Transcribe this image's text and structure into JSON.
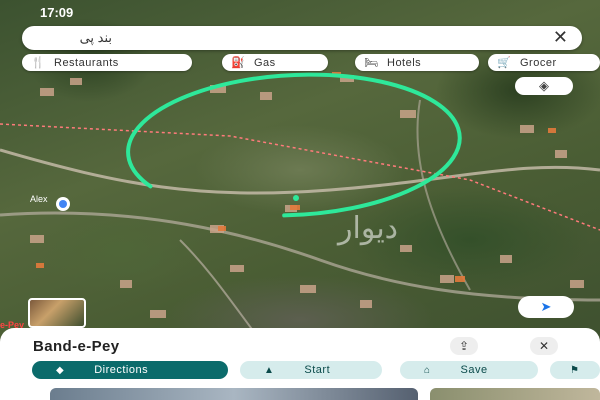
{
  "status_bar": {
    "time": "17:09"
  },
  "search": {
    "query": "بند پی",
    "clear_icon": "close-icon"
  },
  "chips": [
    {
      "label": "Restaurants",
      "icon": "restaurant-icon"
    },
    {
      "label": "Gas",
      "icon": "gas-station-icon"
    },
    {
      "label": "Hotels",
      "icon": "hotel-icon"
    },
    {
      "label": "Grocer",
      "icon": "cart-icon"
    }
  ],
  "map": {
    "layers_icon": "layers-icon",
    "location_label": "Alex",
    "thumbnail_caption": "e-Pey",
    "watermark": "دیوار",
    "locate_icon": "navigation-arrow-icon",
    "colors": {
      "circle": "#2ee89a",
      "road": "#d9c9b8",
      "boundary": "#ff6a6a"
    }
  },
  "place": {
    "name": "Band-e-Pey",
    "share_icon": "share-icon",
    "close_icon": "close-icon"
  },
  "actions": [
    {
      "label": "Directions",
      "icon": "directions-icon",
      "style": "primary"
    },
    {
      "label": "Start",
      "icon": "navigation-icon",
      "style": "secondary"
    },
    {
      "label": "Save",
      "icon": "bookmark-icon",
      "style": "secondary"
    },
    {
      "label": "",
      "icon": "flag-icon",
      "style": "secondary"
    }
  ],
  "theme": {
    "primary": "#0b6b6b",
    "secondary_bg": "#d6ecec",
    "secondary_text": "#0b4b4b"
  }
}
